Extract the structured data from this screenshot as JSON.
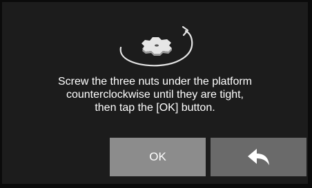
{
  "dialog": {
    "instruction_lines": [
      "Screw the three nuts under the platform",
      "counterclockwise until they are tight,",
      "then tap the [OK] button."
    ],
    "ok_label": "OK",
    "back_icon": "back-arrow-icon",
    "illustration_icon": "nut-rotate-counterclockwise-icon"
  },
  "colors": {
    "background": "#1c1c1c",
    "text": "#ffffff",
    "ok_button": "#8c8c8c",
    "back_button": "#6a6a6a",
    "nut": "#e6e6e6"
  }
}
